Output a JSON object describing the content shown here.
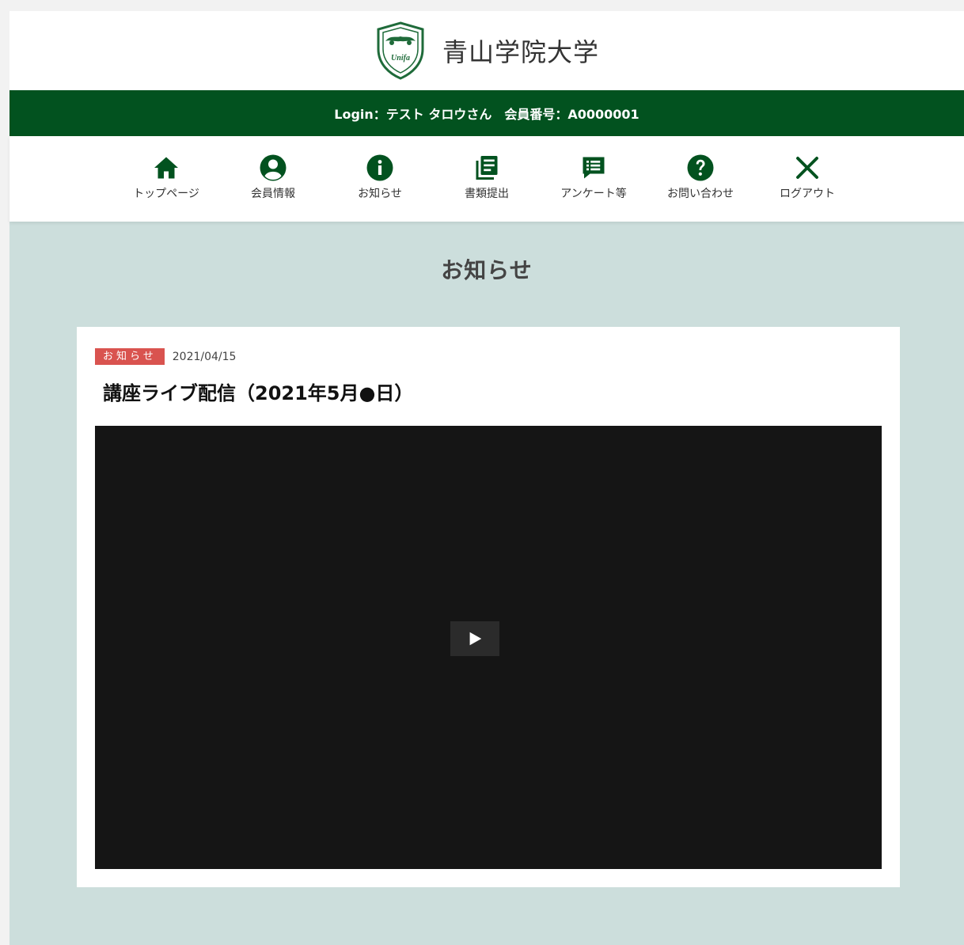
{
  "header": {
    "site_title": "青山学院大学",
    "crest_label": "Unifa"
  },
  "login_bar": {
    "login_text": "Login：テスト タロウさん",
    "member_text": "会員番号：A0000001"
  },
  "nav": {
    "items": [
      {
        "label": "トップページ",
        "icon": "home-icon"
      },
      {
        "label": "会員情報",
        "icon": "user-icon"
      },
      {
        "label": "お知らせ",
        "icon": "info-icon"
      },
      {
        "label": "書類提出",
        "icon": "documents-icon"
      },
      {
        "label": "アンケート等",
        "icon": "survey-icon"
      },
      {
        "label": "お問い合わせ",
        "icon": "help-icon"
      },
      {
        "label": "ログアウト",
        "icon": "close-icon"
      }
    ]
  },
  "main": {
    "section_title": "お知らせ",
    "post": {
      "badge": "お知らせ",
      "date": "2021/04/15",
      "title": "講座ライブ配信（2021年5月●日）"
    },
    "video": {
      "play_icon": "play-icon"
    }
  },
  "colors": {
    "brand_green": "#02521f",
    "page_bg": "#ccdedc",
    "badge_red": "#d9534f",
    "video_bg": "#151515"
  }
}
